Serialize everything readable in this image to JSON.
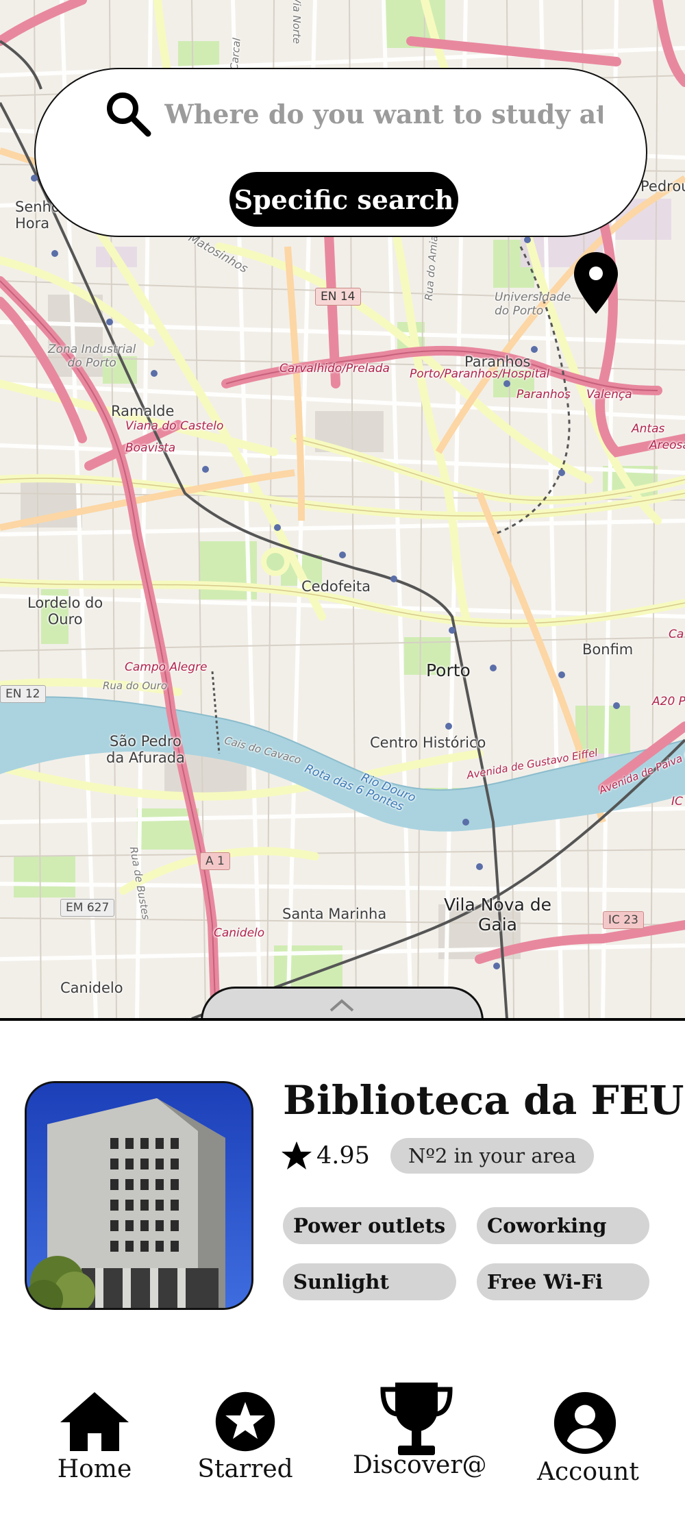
{
  "search": {
    "placeholder": "Where do you want to study at?",
    "specific_label": "Specific search"
  },
  "map": {
    "labels": {
      "senhora": "Senhora\nHora",
      "matosinhos": "Matosinhos",
      "en14": "EN 14",
      "rua_amial": "Rua do Amial",
      "universidade": "Universidade\ndo Porto",
      "zona_industrial": "Zona Industrial\ndo Porto",
      "carvalhido": "Carvalhido/Prelada",
      "porto_paranhos_hospital": "Porto/Paranhos/Hospital",
      "paranhos": "Paranhos",
      "paranhos_station": "Paranhos",
      "valenca": "Valença",
      "antas": "Antas",
      "areosa": "Areosa",
      "ramalde": "Ramalde",
      "viana": "Viana do Castelo",
      "boavista": "Boavista",
      "cedofeita": "Cedofeita",
      "lordelo": "Lordelo do\nOuro",
      "bonfim": "Bonfim",
      "porto": "Porto",
      "campo_alegre": "Campo Alegre",
      "rua_ouro": "Rua do Ouro",
      "en12": "EN 12",
      "a20": "A20 P",
      "sao_pedro": "São Pedro\nda Afurada",
      "centro_historico": "Centro Histórico",
      "cais_cavaco": "Cais do Cavaco",
      "rota_pontes": "Rota das 6 Pontes",
      "rio_douro": "Rio Douro",
      "gustavo_eiffel": "Avenida de Gustavo Eiffel",
      "paiva_couceiro": "Avenida de Paiva Couceiro",
      "a1": "A 1",
      "rua_bustes": "Rua de Bustes",
      "em627": "EM 627",
      "santa_marinha": "Santa Marinha",
      "vila_nova": "Vila Nova de\nGaia",
      "ic23": "IC 23",
      "canidelo_road": "Canidelo",
      "canidelo": "Canidelo",
      "via_norte": "Via Norte",
      "carcal": "Carcal",
      "pedrou": "Pedrou",
      "ca": "Ca",
      "ic": "IC"
    }
  },
  "place": {
    "name": "Biblioteca da FEUP",
    "rating": "4.95",
    "rank": "Nº2 in your area",
    "tags": [
      "Power outlets",
      "Coworking",
      "Sunlight",
      "Free Wi-Fi"
    ]
  },
  "nav": {
    "items": [
      {
        "label": "Home",
        "icon": "home-icon"
      },
      {
        "label": "Starred",
        "icon": "star-badge-icon"
      },
      {
        "label": "Discover@",
        "icon": "trophy-icon"
      },
      {
        "label": "Account",
        "icon": "account-icon"
      }
    ]
  },
  "colors": {
    "map_bg": "#f2efe9",
    "motorway": "#e8889e",
    "trunk": "#f7fabf",
    "river": "#aad3df",
    "park": "#cdebb0",
    "chip_bg": "#d4d4d4",
    "button_bg": "#000000"
  }
}
